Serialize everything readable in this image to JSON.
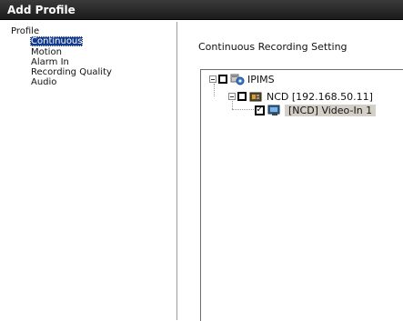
{
  "window": {
    "title": "Add Profile"
  },
  "profile_tree": {
    "root": "Profile",
    "items": [
      {
        "label": "Continuous"
      },
      {
        "label": "Motion"
      },
      {
        "label": "Alarm In"
      },
      {
        "label": "Recording Quality"
      },
      {
        "label": "Audio"
      }
    ]
  },
  "main": {
    "setting_title": "Continuous Recording Setting",
    "device_tree": {
      "root": {
        "label": "IPIMS",
        "checked": false,
        "icon": "server-icon"
      },
      "child": {
        "label": "NCD [192.168.50.11]",
        "checked": false,
        "icon": "ncd-device-icon"
      },
      "leaf": {
        "label": "[NCD] Video-In 1",
        "checked": true,
        "icon": "camera-icon"
      }
    }
  },
  "colors": {
    "titlebar": "#2a2a2a",
    "selection": "#123a8f",
    "leaf_highlight": "#d4d0c8"
  }
}
